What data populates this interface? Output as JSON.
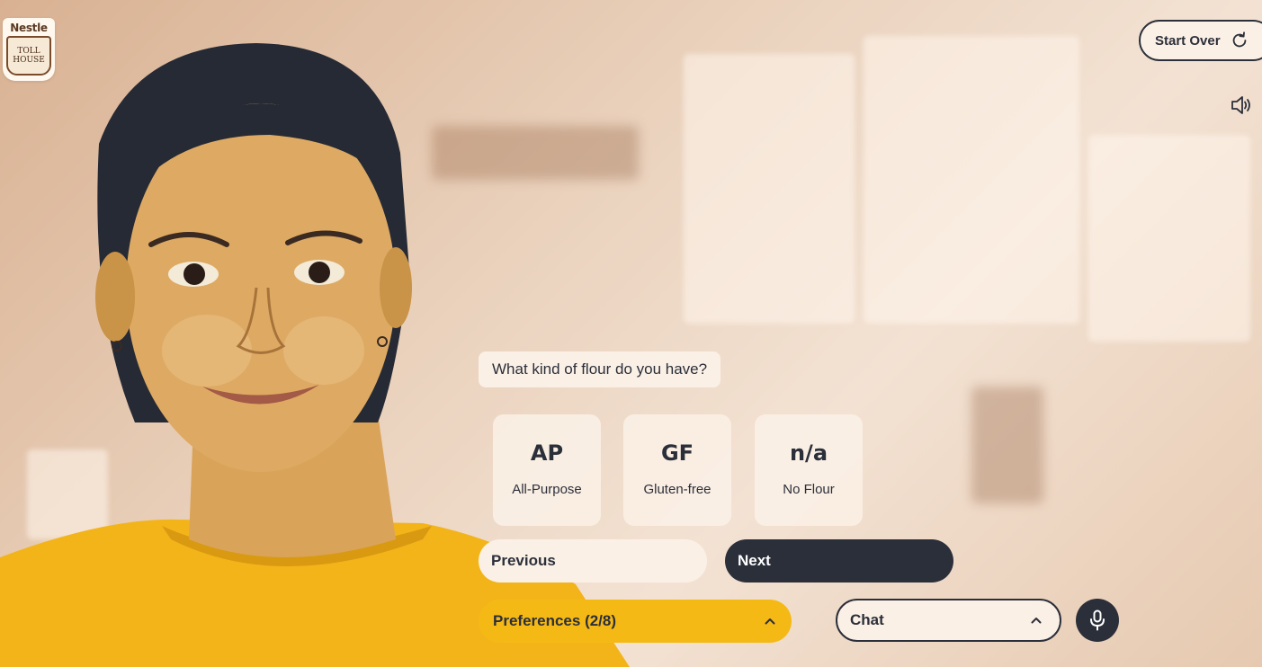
{
  "brand": {
    "logo_top": "Nestle",
    "logo_line1": "TOLL",
    "logo_line2": "HOUSE"
  },
  "header": {
    "start_over_label": "Start Over",
    "start_over_icon": "restart-icon",
    "sound_icon": "speaker-icon"
  },
  "question": {
    "text": "What kind of flour do you have?"
  },
  "options": [
    {
      "abbr": "AP",
      "label": "All-Purpose"
    },
    {
      "abbr": "GF",
      "label": "Gluten-free"
    },
    {
      "abbr": "n/a",
      "label": "No Flour"
    }
  ],
  "nav": {
    "previous_label": "Previous",
    "next_label": "Next"
  },
  "footer": {
    "preferences_label": "Preferences (2/8)",
    "chat_label": "Chat",
    "mic_icon": "microphone-icon"
  },
  "colors": {
    "dark": "#2b2f3a",
    "cream": "#fbf0e6",
    "accent_yellow": "#f5b915"
  }
}
